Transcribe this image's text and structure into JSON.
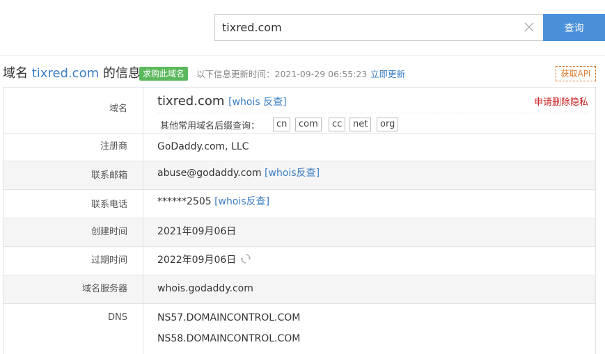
{
  "search": {
    "value": "tixred.com",
    "button_label": "查询"
  },
  "header": {
    "prefix": "域名",
    "domain": "tixred.com",
    "suffix": "的信息",
    "buy_badge": "求购此域名",
    "update_text": "以下信息更新时间：2021-09-29 06:55:23",
    "update_link": "立即更新",
    "api_label": "获取API"
  },
  "domain_row": {
    "label": "域名",
    "domain": "tixred.com",
    "whois_link": "[whois 反查]",
    "privacy_link": "申请删除隐私",
    "suffix_label": "其他常用域名后缀查询：",
    "suffixes": [
      "cn",
      "com",
      "cc",
      "net",
      "org"
    ]
  },
  "registrar": {
    "label": "注册商",
    "value": "GoDaddy.com, LLC"
  },
  "email": {
    "label": "联系邮箱",
    "value": "abuse@godaddy.com",
    "link": "[whois反查]"
  },
  "phone": {
    "label": "联系电话",
    "value": "******2505",
    "link": "[whois反查]"
  },
  "created": {
    "label": "创建时间",
    "value": "2021年09月06日"
  },
  "expires": {
    "label": "过期时间",
    "value": "2022年09月06日"
  },
  "nameserver": {
    "label": "域名服务器",
    "value": "whois.godaddy.com"
  },
  "dns": {
    "label": "DNS",
    "values": [
      "NS57.DOMAINCONTROL.COM",
      "NS58.DOMAINCONTROL.COM"
    ]
  },
  "colors": {
    "accent": "#4a90d9",
    "link": "#3b7dc4",
    "badge": "#5cb85c",
    "privacy": "#cc1f1f",
    "api": "#e07b2e"
  }
}
